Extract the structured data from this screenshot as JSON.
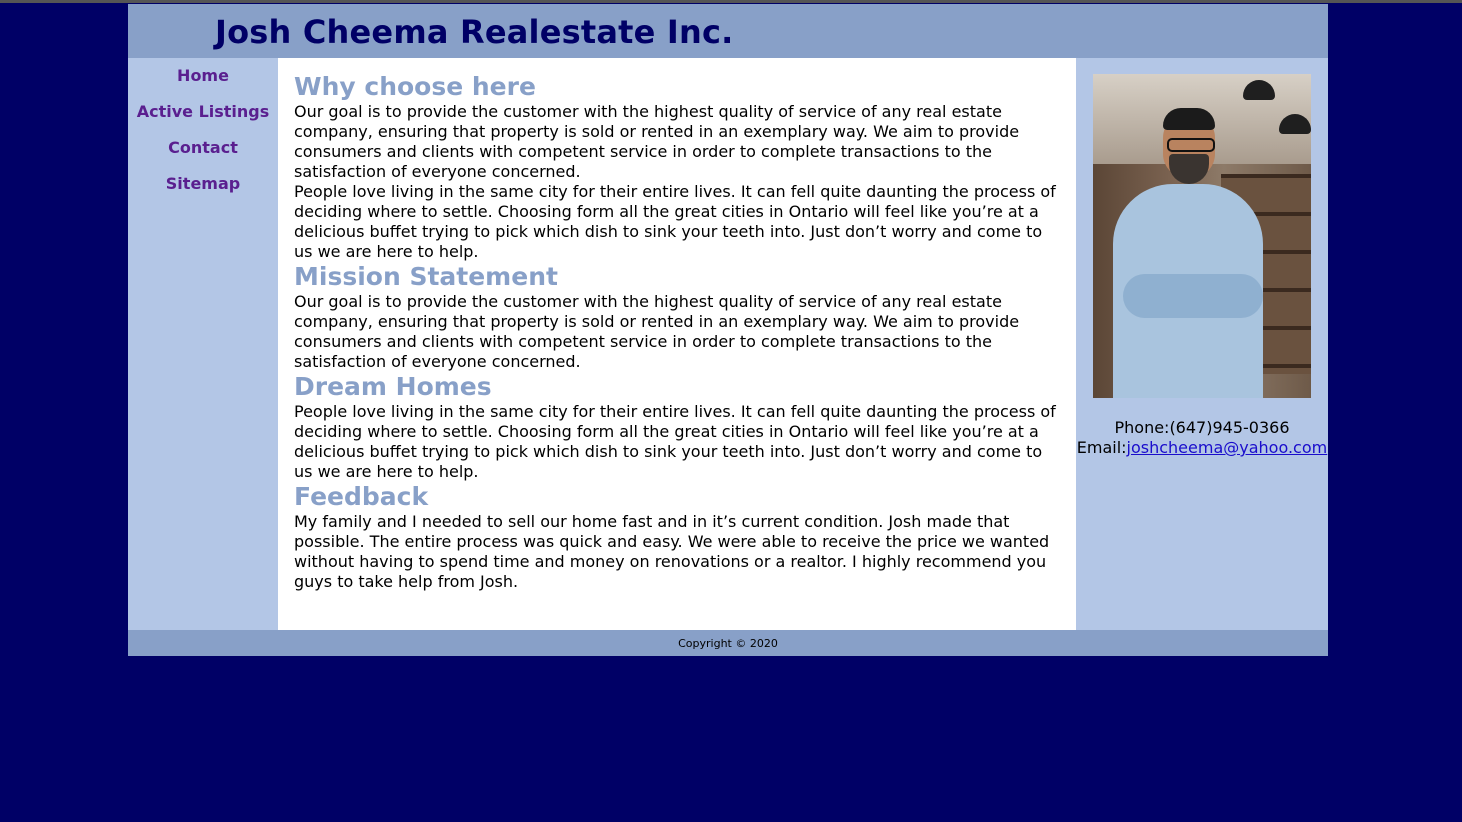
{
  "site": {
    "title": "Josh Cheema Realestate Inc."
  },
  "nav": {
    "items": [
      "Home",
      "Active Listings",
      "Contact",
      "Sitemap"
    ]
  },
  "sections": [
    {
      "heading": "Why choose here",
      "paragraphs": [
        "Our goal is to provide the customer with the highest quality of service of any real estate company, ensuring that property is sold or rented in an exemplary way. We aim to provide consumers and clients with competent service in order to complete transactions to the satisfaction of everyone concerned.",
        "People love living in the same city for their entire lives. It can fell quite daunting the process of deciding where to settle. Choosing form all the great cities in Ontario will feel like you’re at a delicious buffet trying to pick which dish to sink your teeth into. Just don’t worry and come to us we are here to help."
      ]
    },
    {
      "heading": "Mission Statement",
      "paragraphs": [
        "Our goal is to provide the customer with the highest quality of service of any real estate company, ensuring that property is sold or rented in an exemplary way. We aim to provide consumers and clients with competent service in order to complete transactions to the satisfaction of everyone concerned."
      ]
    },
    {
      "heading": "Dream Homes",
      "paragraphs": [
        "People love living in the same city for their entire lives. It can fell quite daunting the process of deciding where to settle. Choosing form all the great cities in Ontario will feel like you’re at a delicious buffet trying to pick which dish to sink your teeth into. Just don’t worry and come to us we are here to help."
      ]
    },
    {
      "heading": "Feedback",
      "paragraphs": [
        "My family and I needed to sell our home fast and in it’s current condition. Josh made that possible. The entire process was quick and easy. We were able to receive the price we wanted without having to spend time and money on renovations or a realtor. I highly recommend you guys to take help from Josh."
      ]
    }
  ],
  "contact": {
    "phone_label": "Phone:",
    "phone": "(647)945-0366",
    "email_label": "Email:",
    "email": "joshcheema@yahoo.com"
  },
  "footer": {
    "copyright": "Copyright © 2020"
  },
  "colors": {
    "page_bg": "#000066",
    "header_bg": "#88a0c8",
    "sidebar_bg": "#b3c6e6",
    "heading": "#88a0c8",
    "nav_link": "#5a1f8f"
  }
}
